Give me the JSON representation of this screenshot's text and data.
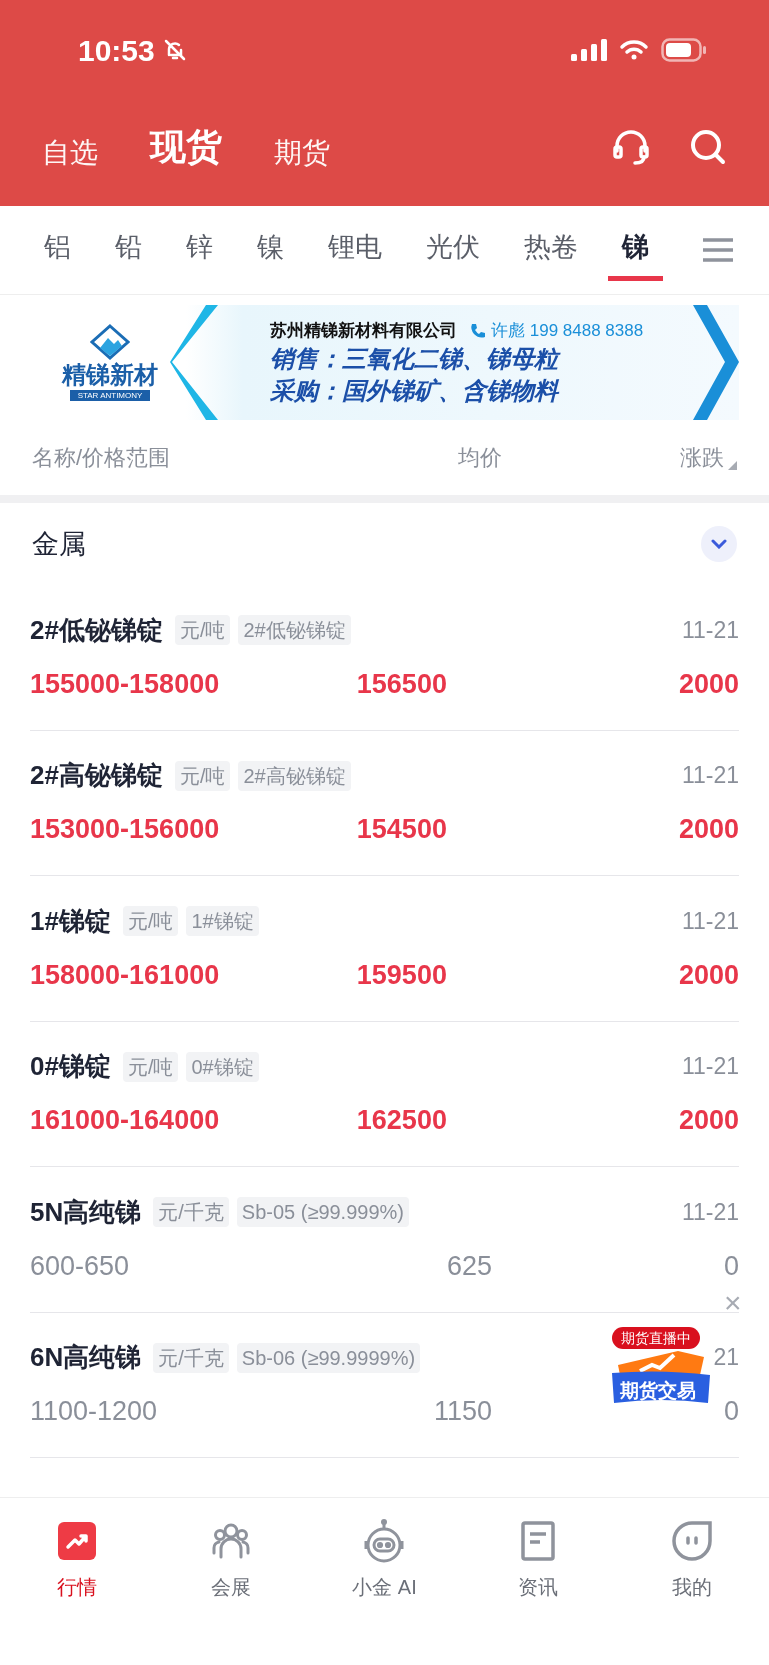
{
  "status_bar": {
    "time": "10:53",
    "muted": true
  },
  "top_tabs": [
    {
      "label": "自选",
      "selected": false
    },
    {
      "label": "现货",
      "selected": true
    },
    {
      "label": "期货",
      "selected": false
    }
  ],
  "categories": [
    {
      "label": "铝",
      "selected": false
    },
    {
      "label": "铅",
      "selected": false
    },
    {
      "label": "锌",
      "selected": false
    },
    {
      "label": "镍",
      "selected": false
    },
    {
      "label": "锂电",
      "selected": false
    },
    {
      "label": "光伏",
      "selected": false
    },
    {
      "label": "热卷",
      "selected": false
    },
    {
      "label": "锑",
      "selected": true
    }
  ],
  "banner": {
    "brand": "精锑新材",
    "brand_en": "STAR ANTIMONY",
    "company": "苏州精锑新材料有限公司",
    "contact": "许彪 199 8488 8388",
    "line_1": "销售：三氧化二锑、锑母粒",
    "line_2": "采购：国外锑矿、含锑物料"
  },
  "columns": [
    "名称/价格范围",
    "均价",
    "涨跌"
  ],
  "section": {
    "title": "金属",
    "expanded": true
  },
  "rows": [
    {
      "name": "2#低铋锑锭",
      "unit": "元/吨",
      "spec": "2#低铋锑锭",
      "date": "11-21",
      "range": "155000-158000",
      "avg": "156500",
      "change": "2000",
      "rising": true
    },
    {
      "name": "2#高铋锑锭",
      "unit": "元/吨",
      "spec": "2#高铋锑锭",
      "date": "11-21",
      "range": "153000-156000",
      "avg": "154500",
      "change": "2000",
      "rising": true
    },
    {
      "name": "1#锑锭",
      "unit": "元/吨",
      "spec": "1#锑锭",
      "date": "11-21",
      "range": "158000-161000",
      "avg": "159500",
      "change": "2000",
      "rising": true
    },
    {
      "name": "0#锑锭",
      "unit": "元/吨",
      "spec": "0#锑锭",
      "date": "11-21",
      "range": "161000-164000",
      "avg": "162500",
      "change": "2000",
      "rising": true
    },
    {
      "name": "5N高纯锑",
      "unit": "元/千克",
      "spec": "Sb-05 (≥99.999%)",
      "date": "11-21",
      "range": "600-650",
      "avg": "625",
      "change": "0",
      "rising": false
    },
    {
      "name": "6N高纯锑",
      "unit": "元/千克",
      "spec": "Sb-06 (≥99.9999%)",
      "date": "21",
      "range": "1100-1200",
      "avg": "1150",
      "change": "0",
      "rising": false
    }
  ],
  "float_ad": {
    "badge": "期货直播中",
    "label": "期货交易",
    "close": "×"
  },
  "bottom_nav": [
    {
      "label": "行情",
      "selected": true
    },
    {
      "label": "会展",
      "selected": false
    },
    {
      "label": "小金 AI",
      "selected": false
    },
    {
      "label": "资讯",
      "selected": false
    },
    {
      "label": "我的",
      "selected": false
    }
  ]
}
